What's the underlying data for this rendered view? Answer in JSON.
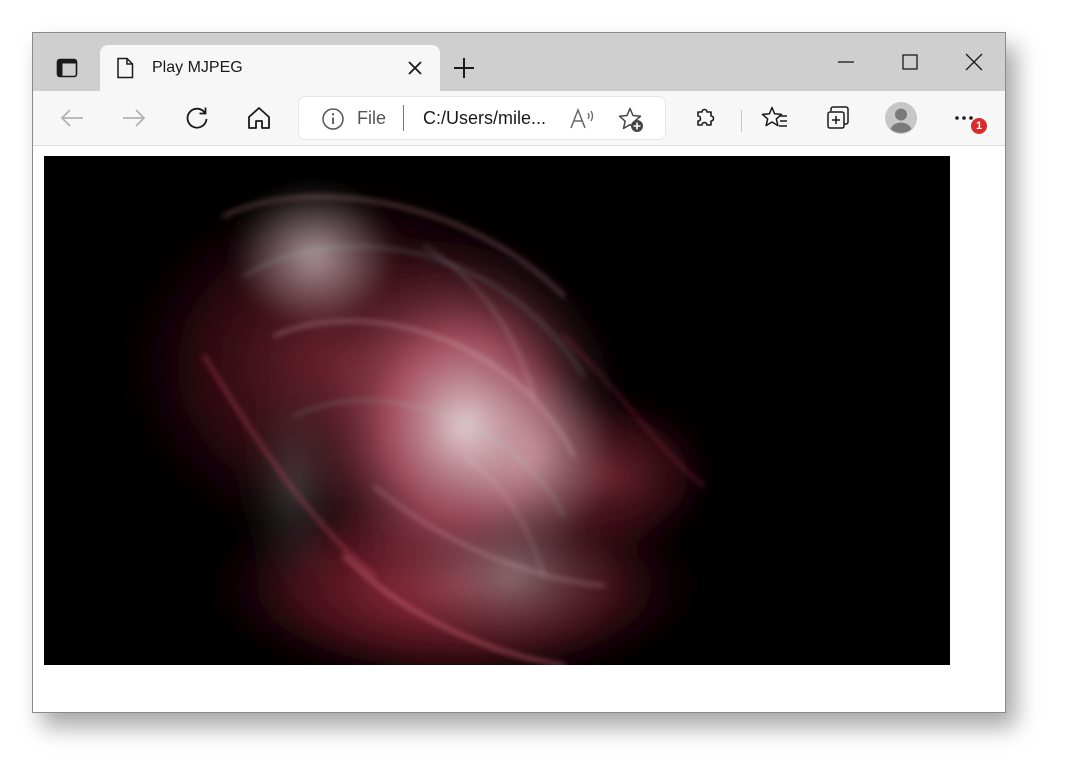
{
  "browser": {
    "tab": {
      "title": "Play MJPEG"
    },
    "address_bar": {
      "scheme_label": "File",
      "url": "C:/Users/mile..."
    },
    "notification_badge": "1"
  },
  "icons": {
    "tab_actions": "tab-actions-icon",
    "page": "page-icon",
    "tab_close": "close-icon",
    "new_tab": "plus-icon",
    "minimize": "minimize-icon",
    "maximize": "maximize-icon",
    "close_window": "close-icon",
    "back": "back-arrow-icon",
    "forward": "forward-arrow-icon",
    "refresh": "refresh-icon",
    "home": "home-icon",
    "info": "info-icon",
    "read_aloud": "read-aloud-icon",
    "add_favorite": "star-plus-icon",
    "extensions": "puzzle-icon",
    "favorites": "favorites-icon",
    "collections": "collections-icon",
    "profile": "avatar-icon",
    "more": "ellipsis-icon"
  },
  "colors": {
    "tabstrip": "#cfcfcf",
    "toolbar": "#f7f7f7",
    "badge": "#d92b2b",
    "video_background": "#000000"
  }
}
